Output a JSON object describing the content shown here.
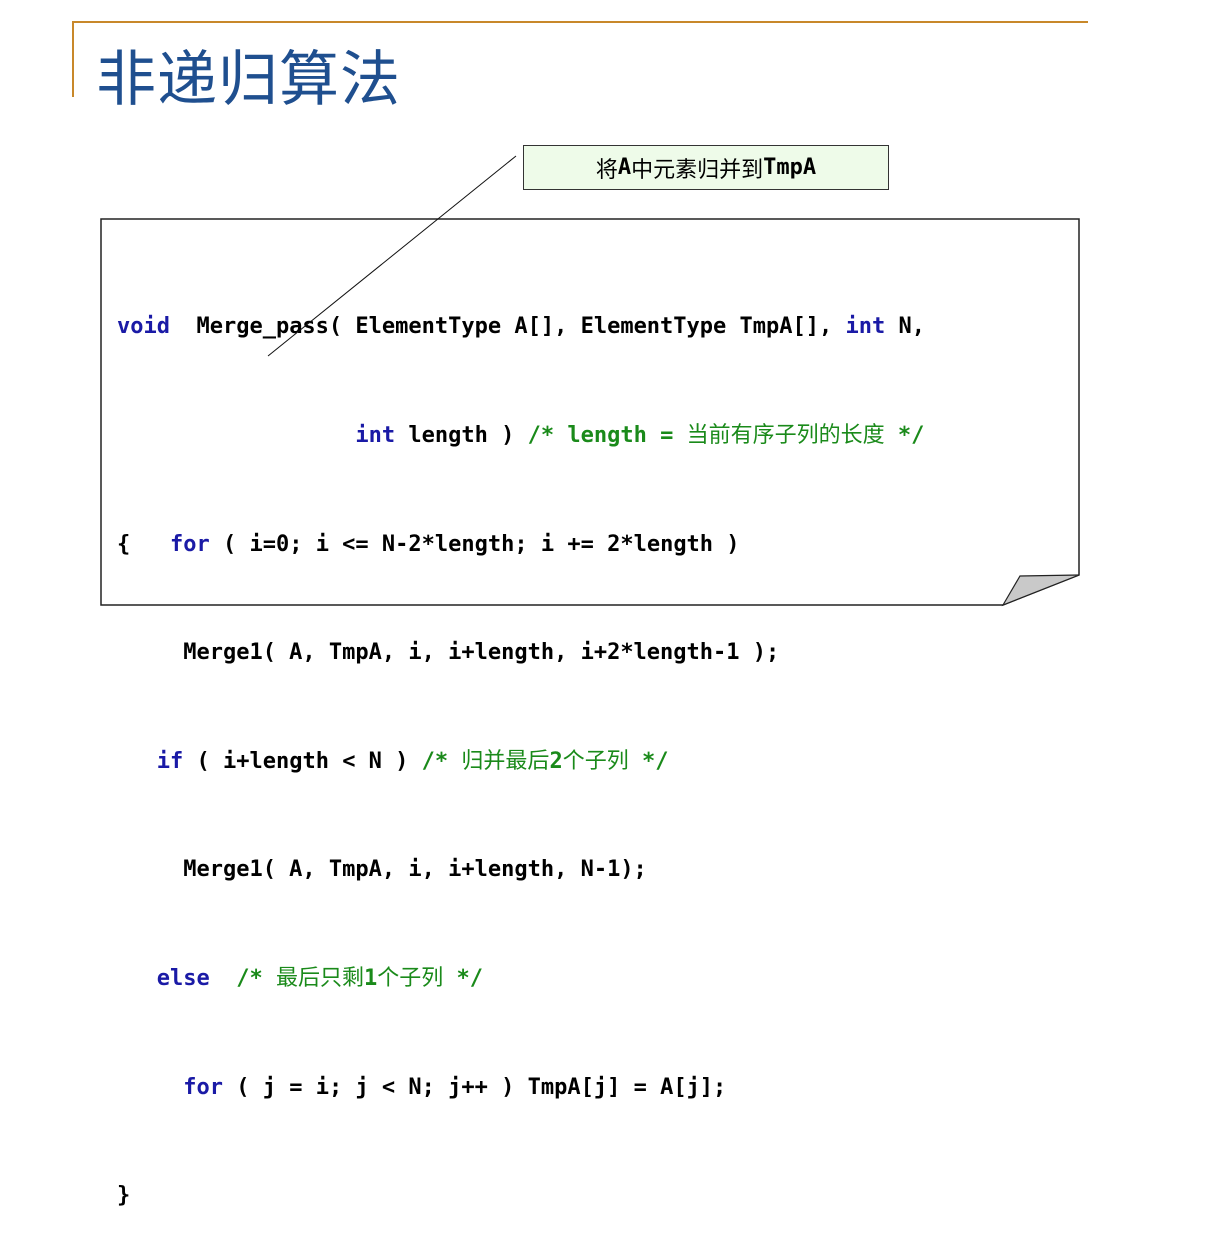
{
  "title": "非递归算法",
  "callout": {
    "prefix": "将",
    "a": "A",
    "middle": "中元素归并到",
    "target": "TmpA"
  },
  "code": {
    "l1_kw": "void",
    "l1_rest": "  Merge_pass( ElementType A[], ElementType TmpA[], ",
    "l1_kw2": "int",
    "l1_end": " N,",
    "l2_indent": "                  ",
    "l2_kw": "int",
    "l2_rest": " length ) ",
    "l2_cm": "/* length = ",
    "l2_cm_cjk": "当前有序子列的长度",
    "l2_cm_end": " */",
    "l3_brace": "{   ",
    "l3_kw": "for",
    "l3_rest": " ( i=0; i <= N-2*length; i += 2*length )",
    "l4": "     Merge1( A, TmpA, i, i+length, i+2*length-1 );",
    "l5_indent": "   ",
    "l5_kw": "if",
    "l5_rest": " ( i+length < N ) ",
    "l5_cm": "/* ",
    "l5_cm_cjk": "归并最后",
    "l5_cm_num": "2",
    "l5_cm_cjk2": "个子列",
    "l5_cm_end": " */",
    "l6": "     Merge1( A, TmpA, i, i+length, N-1);",
    "l7_indent": "   ",
    "l7_kw": "else",
    "l7_rest": "  ",
    "l7_cm": "/* ",
    "l7_cm_cjk": "最后只剩",
    "l7_cm_num": "1",
    "l7_cm_cjk2": "个子列",
    "l7_cm_end": " */",
    "l8_indent": "     ",
    "l8_kw": "for",
    "l8_rest": " ( j = i; j < N; j++ ) TmpA[j] = A[j];",
    "l9": "}"
  },
  "colors": {
    "keyword": "#1a1aa6",
    "comment": "#1a8a1a",
    "title": "#1f4f8f",
    "accent_rule": "#c8882a",
    "callout_bg": "#eefbe9"
  }
}
